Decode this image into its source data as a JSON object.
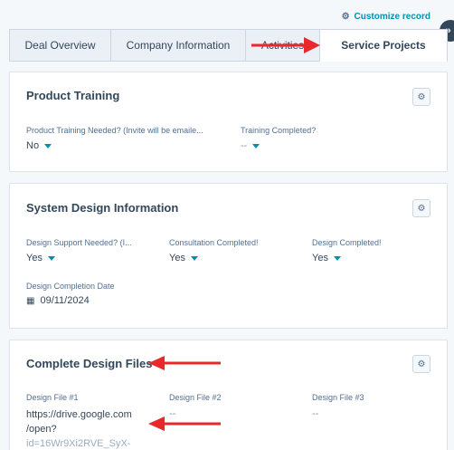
{
  "header": {
    "customize_label": "Customize record",
    "customize_icon": "gear-icon",
    "collapse_label": "»"
  },
  "tabs": [
    {
      "label": "Deal Overview",
      "active": false
    },
    {
      "label": "Company Information",
      "active": false
    },
    {
      "label": "Activities",
      "active": false
    },
    {
      "label": "Service Projects",
      "active": true
    }
  ],
  "cards": {
    "product_training": {
      "title": "Product Training",
      "fields": [
        {
          "label": "Product Training Needed? (Invite will be emaile...",
          "value": "No"
        },
        {
          "label": "Training Completed?",
          "value": "--"
        }
      ]
    },
    "system_design": {
      "title": "System Design Information",
      "fields": [
        {
          "label": "Design Support Needed? (I...",
          "value": "Yes"
        },
        {
          "label": "Consultation Completed!",
          "value": "Yes"
        },
        {
          "label": "Design Completed!",
          "value": "Yes"
        }
      ],
      "date_field": {
        "label": "Design Completion Date",
        "value": "09/11/2024"
      }
    },
    "design_files": {
      "title": "Complete Design Files",
      "file1": {
        "label": "Design File #1",
        "line1": "https://drive.google.com",
        "line2": "/open?",
        "line3": "id=16Wr9Xi2RVE_SyX-"
      },
      "file2": {
        "label": "Design File #2",
        "value": "--"
      },
      "file3": {
        "label": "Design File #3",
        "value": "--"
      }
    }
  },
  "colors": {
    "accent": "#0091ae",
    "annotation_arrow": "#e8282b",
    "text": "#33475b"
  }
}
